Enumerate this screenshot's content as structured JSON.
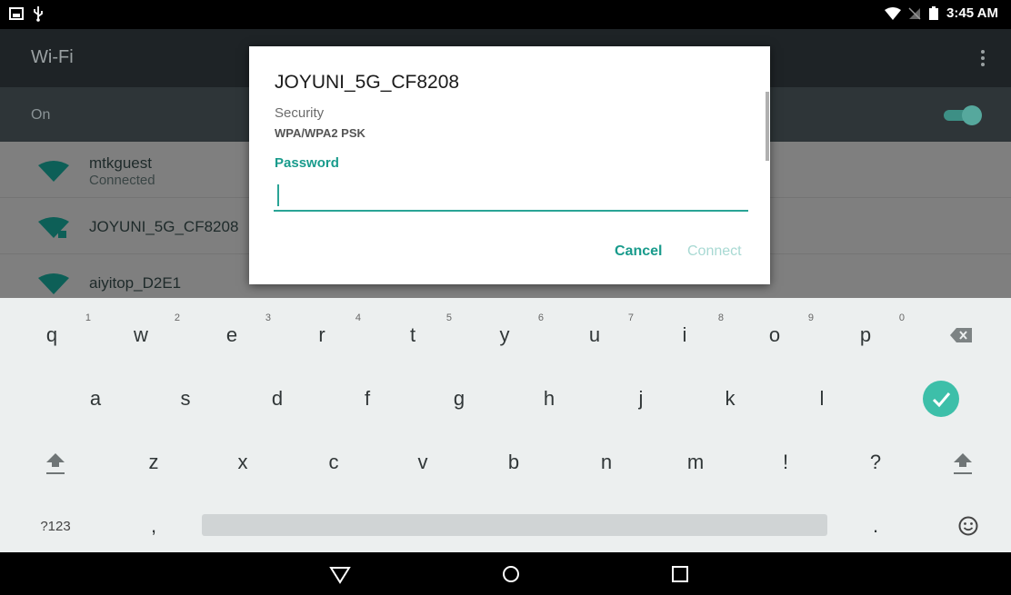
{
  "status_bar": {
    "time": "3:45 AM"
  },
  "wifi": {
    "title": "Wi-Fi",
    "on_label": "On",
    "networks": [
      {
        "name": "mtkguest",
        "status": "Connected"
      },
      {
        "name": "JOYUNI_5G_CF8208",
        "status": ""
      },
      {
        "name": "aiyitop_D2E1",
        "status": ""
      }
    ]
  },
  "dialog": {
    "title": "JOYUNI_5G_CF8208",
    "security_label": "Security",
    "security_value": "WPA/WPA2 PSK",
    "password_label": "Password",
    "password_value": "",
    "cancel_label": "Cancel",
    "connect_label": "Connect"
  },
  "keyboard": {
    "row1": [
      {
        "key": "q",
        "hint": "1"
      },
      {
        "key": "w",
        "hint": "2"
      },
      {
        "key": "e",
        "hint": "3"
      },
      {
        "key": "r",
        "hint": "4"
      },
      {
        "key": "t",
        "hint": "5"
      },
      {
        "key": "y",
        "hint": "6"
      },
      {
        "key": "u",
        "hint": "7"
      },
      {
        "key": "i",
        "hint": "8"
      },
      {
        "key": "o",
        "hint": "9"
      },
      {
        "key": "p",
        "hint": "0"
      }
    ],
    "row2": [
      "a",
      "s",
      "d",
      "f",
      "g",
      "h",
      "j",
      "k",
      "l"
    ],
    "row3": [
      "z",
      "x",
      "c",
      "v",
      "b",
      "n",
      "m",
      "!",
      "?"
    ],
    "symbols_label": "?123",
    "comma": ",",
    "period": "."
  },
  "colors": {
    "accent": "#199b8c",
    "accent_light": "#a8d9d3"
  }
}
